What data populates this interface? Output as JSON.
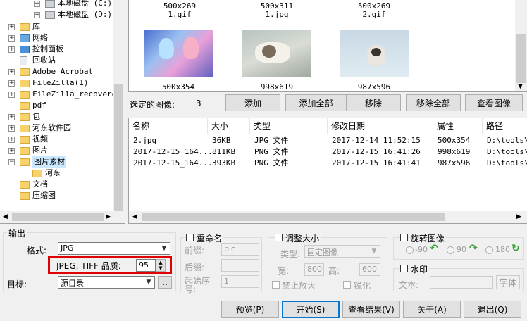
{
  "tree": {
    "items": [
      {
        "label": "本地磁盘 (C:)",
        "icon": "drive-icon"
      },
      {
        "label": "本地磁盘 (D:)",
        "icon": "drive-icon"
      },
      {
        "label": "库",
        "icon": "folder-icon"
      },
      {
        "label": "网络",
        "icon": "network-icon"
      },
      {
        "label": "控制面板",
        "icon": "control-panel-icon"
      },
      {
        "label": "回收站",
        "icon": "recycle-bin-icon"
      },
      {
        "label": "Adobe Acrobat",
        "icon": "folder-icon"
      },
      {
        "label": "FileZilla(1)",
        "icon": "folder-icon"
      },
      {
        "label": "FileZilla_recovered",
        "icon": "folder-icon"
      },
      {
        "label": "pdf",
        "icon": "folder-icon"
      },
      {
        "label": "包",
        "icon": "folder-icon"
      },
      {
        "label": "河东软件园",
        "icon": "folder-icon"
      },
      {
        "label": "视频",
        "icon": "folder-icon"
      },
      {
        "label": "图片",
        "icon": "folder-icon"
      },
      {
        "label": "图片素材",
        "icon": "folder-icon"
      },
      {
        "label": "河东",
        "icon": "folder-icon"
      },
      {
        "label": "文档",
        "icon": "folder-icon"
      },
      {
        "label": "压缩图",
        "icon": "folder-icon"
      }
    ]
  },
  "thumbs": {
    "top": [
      {
        "size": "500x269",
        "name": "1.gif"
      },
      {
        "size": "500x311",
        "name": "1.jpg"
      },
      {
        "size": "500x269",
        "name": "2.gif"
      }
    ],
    "main": [
      {
        "size": "500x354"
      },
      {
        "size": "998x619"
      },
      {
        "size": "987x596"
      }
    ]
  },
  "selected": {
    "label": "选定的图像:",
    "count": "3",
    "add": "添加",
    "add_all": "添加全部",
    "remove": "移除",
    "remove_all": "移除全部",
    "view": "查看图像"
  },
  "filelist": {
    "columns": [
      "名称",
      "大小",
      "类型",
      "修改日期",
      "属性",
      "路径"
    ],
    "rows": [
      [
        "2.jpg",
        "36KB",
        "JPG 文件",
        "2017-12-14 11:52:15",
        "500x354",
        "D:\\tools\\"
      ],
      [
        "2017-12-15_164...",
        "811KB",
        "PNG 文件",
        "2017-12-15 16:41:26",
        "998x619",
        "D:\\tools\\"
      ],
      [
        "2017-12-15_164...",
        "393KB",
        "PNG 文件",
        "2017-12-15 16:41:41",
        "987x596",
        "D:\\tools\\"
      ]
    ]
  },
  "output": {
    "group_label": "输出",
    "format_label": "格式:",
    "format_value": "JPG",
    "quality_label": "JPEG, TIFF 品质:",
    "quality_value": "95",
    "target_label": "目标:",
    "target_value": "源目录",
    "browse": ".."
  },
  "rename": {
    "label": "重命名",
    "prefix_label": "前缀:",
    "prefix_value": "pic",
    "suffix_label": "后缀:",
    "start_label": "起始序号:",
    "start_value": "1"
  },
  "resize": {
    "label": "调整大小",
    "type_label": "类型:",
    "type_value": "固定图像",
    "width_label": "宽:",
    "width_value": "800",
    "height_label": "高:",
    "height_value": "600",
    "no_enlarge": "禁止放大",
    "sharpen": "锐化"
  },
  "rotate": {
    "label": "旋转图像",
    "opt1": "-90",
    "opt2": "90",
    "opt3": "180"
  },
  "watermark": {
    "label": "水印",
    "text_label": "文本:",
    "font_button": "字体"
  },
  "actions": {
    "preview": "预览(P)",
    "start": "开始(S)",
    "results": "查看结果(V)",
    "about": "关于(A)",
    "exit": "退出(Q)"
  },
  "colors": {
    "accent": "#0078d7",
    "highlight_box": "#e00000"
  }
}
